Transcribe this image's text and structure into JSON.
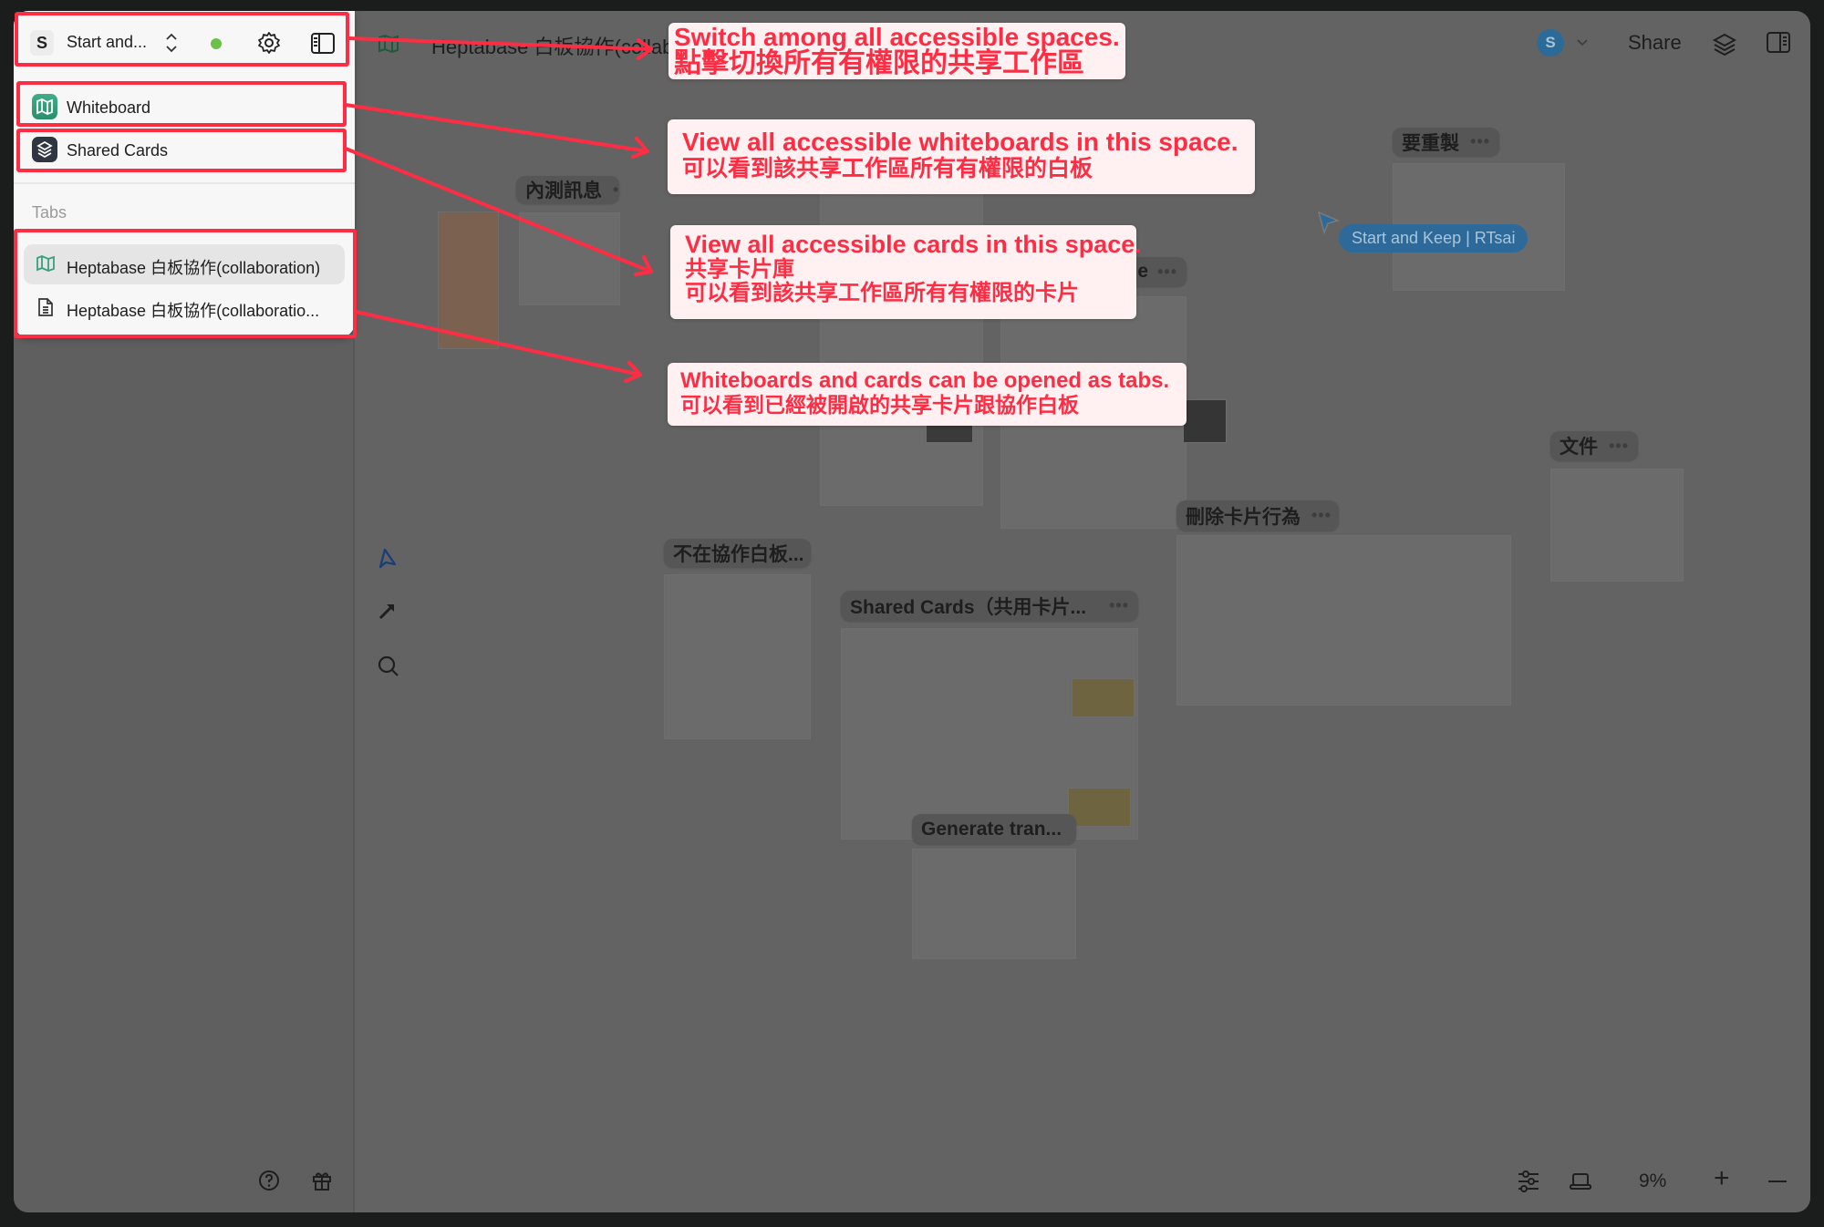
{
  "sidebar": {
    "space": {
      "initial": "S",
      "name": "Start and...",
      "status_color": "#6cc04a"
    },
    "nav": [
      {
        "label": "Whiteboard",
        "icon": "map-icon"
      },
      {
        "label": "Shared Cards",
        "icon": "layers-icon"
      }
    ],
    "tabs_heading": "Tabs",
    "tabs": [
      {
        "label": "Heptabase 白板協作(collaboration)",
        "icon": "map-icon",
        "active": true
      },
      {
        "label": "Heptabase 白板協作(collaboratio...",
        "icon": "document-icon",
        "active": false
      }
    ]
  },
  "topbar": {
    "breadcrumb_title": "Heptabase 白板協作(collaboration)",
    "avatar_initial": "S",
    "share_label": "Share"
  },
  "zoom": {
    "level": "9%"
  },
  "canvas": {
    "sections": [
      "內測訊息",
      "要重製",
      "e",
      "文件",
      "刪除卡片行為",
      "不在協作白板...",
      "Shared Cards（共用卡片...",
      "Generate tran..."
    ],
    "collaborator_cursor": "Start and Keep | RTsai",
    "collaborator_color": "#2d6a9a"
  },
  "annotations": [
    {
      "lines": [
        "Switch among all accessible spaces.",
        "點擊切換所有有權限的共享工作區"
      ]
    },
    {
      "lines": [
        "View all accessible whiteboards in this space.",
        "可以看到該共享工作區所有有權限的白板"
      ]
    },
    {
      "lines": [
        "View all accessible cards in this space.",
        "共享卡片庫",
        "可以看到該共享工作區所有有權限的卡片"
      ]
    },
    {
      "lines": [
        "Whiteboards and cards can be opened as tabs.",
        "可以看到已經被開啟的共享卡片跟協作白板"
      ]
    }
  ],
  "annotation_color": "#ff2d44"
}
